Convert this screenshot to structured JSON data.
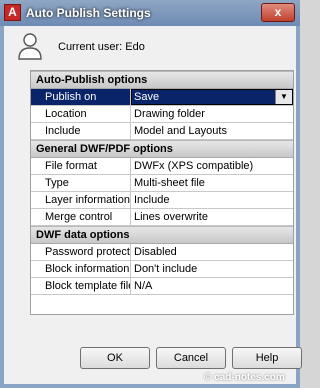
{
  "window": {
    "title": "Auto Publish Settings",
    "icon_letter": "A",
    "close_glyph": "x"
  },
  "user": {
    "label": "Current user: Edo"
  },
  "sections": [
    {
      "title": "Auto-Publish options",
      "rows": [
        {
          "label": "Publish on",
          "value": "Save",
          "selected": true
        },
        {
          "label": "Location",
          "value": "Drawing folder"
        },
        {
          "label": "Include",
          "value": "Model and Layouts"
        }
      ]
    },
    {
      "title": "General DWF/PDF options",
      "rows": [
        {
          "label": "File format",
          "value": "DWFx (XPS compatible)"
        },
        {
          "label": "Type",
          "value": "Multi-sheet file"
        },
        {
          "label": "Layer information",
          "value": "Include"
        },
        {
          "label": "Merge control",
          "value": "Lines overwrite"
        }
      ]
    },
    {
      "title": "DWF data options",
      "rows": [
        {
          "label": "Password protection",
          "value": "Disabled"
        },
        {
          "label": "Block information",
          "value": "Don't include"
        },
        {
          "label": "Block template file",
          "value": "N/A"
        }
      ]
    }
  ],
  "buttons": {
    "ok": "OK",
    "cancel": "Cancel",
    "help": "Help"
  },
  "watermark": "© cad-notes.com",
  "icons": {
    "dropdown": "chevron-down-icon",
    "user": "user-icon",
    "app": "autocad-app-icon"
  }
}
